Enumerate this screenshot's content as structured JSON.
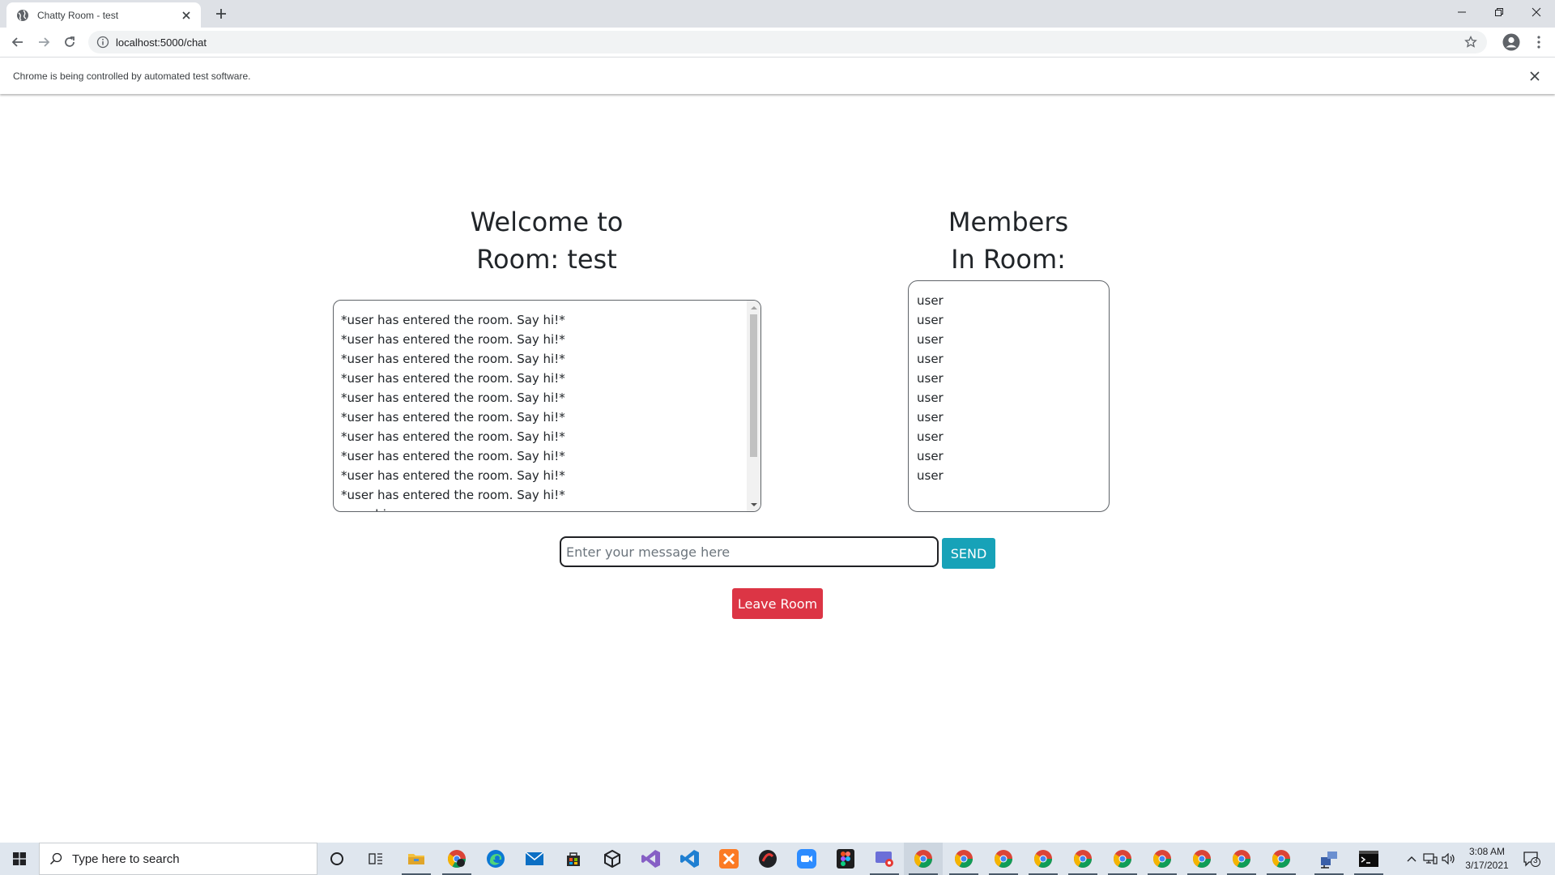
{
  "browser": {
    "tab_title": "Chatty Room - test",
    "url": "localhost:5000/chat",
    "infobar_text": "Chrome is being controlled by automated test software."
  },
  "page": {
    "welcome_line1": "Welcome to",
    "welcome_line2": "Room: test",
    "members_line1": "Members",
    "members_line2": "In Room:",
    "messages": [
      "*user has entered the room. Say hi!*",
      "*user has entered the room. Say hi!*",
      "*user has entered the room. Say hi!*",
      "*user has entered the room. Say hi!*",
      "*user has entered the room. Say hi!*",
      "*user has entered the room. Say hi!*",
      "*user has entered the room. Say hi!*",
      "*user has entered the room. Say hi!*",
      "*user has entered the room. Say hi!*",
      "*user has entered the room. Say hi!*",
      "user: hi"
    ],
    "members": [
      "user",
      "user",
      "user",
      "user",
      "user",
      "user",
      "user",
      "user",
      "user",
      "user"
    ],
    "message_placeholder": "Enter your message here",
    "send_label": "SEND",
    "leave_label": "Leave Room"
  },
  "taskbar": {
    "search_placeholder": "Type here to search",
    "time": "3:08 AM",
    "date": "3/17/2021",
    "notification_count": "3"
  },
  "colors": {
    "send_button": "#17a2b8",
    "leave_button": "#dc3545"
  }
}
